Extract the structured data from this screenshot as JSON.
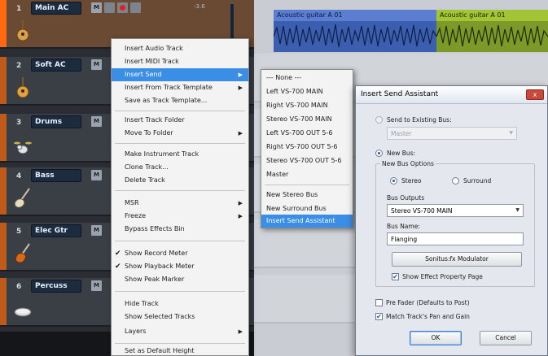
{
  "tracks": [
    {
      "num": "1",
      "name": "Main AC",
      "db": "-3.6",
      "selected": true
    },
    {
      "num": "2",
      "name": "Soft AC"
    },
    {
      "num": "3",
      "name": "Drums"
    },
    {
      "num": "4",
      "name": "Bass"
    },
    {
      "num": "5",
      "name": "Elec Gtr"
    },
    {
      "num": "6",
      "name": "Percuss"
    }
  ],
  "track_buttons": {
    "mute": "M"
  },
  "clips": {
    "clip_a_title": "Acoustic guitar A 01",
    "clip_b_title": "Acoustic guitar A 01",
    "clip_a_color": "#3b5fae",
    "clip_b_color": "#7c9a28"
  },
  "context_menu": {
    "items": [
      "Insert Audio Track",
      "Insert MIDI Track",
      "Insert Send",
      "Insert From Track Template",
      "Save as Track Template...",
      "Insert Track Folder",
      "Move To Folder",
      "Make Instrument Track",
      "Clone Track...",
      "Delete Track",
      "MSR",
      "Freeze",
      "Bypass Effects Bin",
      "Show Record Meter",
      "Show Playback Meter",
      "Show Peak Marker",
      "Hide Track",
      "Show Selected Tracks",
      "Layers",
      "Set as Default Height"
    ],
    "highlighted": "Insert Send",
    "highlight_color": "#3a8ee6"
  },
  "submenu": {
    "items": [
      "--- None ---",
      "Left VS-700 MAIN",
      "Right VS-700 MAIN",
      "Stereo VS-700 MAIN",
      "Left VS-700 OUT 5-6",
      "Right VS-700 OUT 5-6",
      "Stereo VS-700 OUT 5-6",
      "Master",
      "New Stereo Bus",
      "New Surround Bus",
      "Insert Send Assistant"
    ],
    "highlighted": "Insert Send Assistant"
  },
  "dialog": {
    "title": "Insert Send Assistant",
    "close_label": "x",
    "send_existing_label": "Send to Existing Bus:",
    "existing_bus_value": "Master",
    "new_bus_label": "New Bus:",
    "new_bus_options_label": "New Bus Options",
    "stereo_label": "Stereo",
    "surround_label": "Surround",
    "bus_outputs_label": "Bus Outputs",
    "bus_outputs_value": "Stereo VS-700 MAIN",
    "bus_name_label": "Bus Name:",
    "bus_name_value": "Flanging",
    "effect_button": "Sonitus:fx Modulator",
    "show_effect_label": "Show Effect Property Page",
    "pre_fader_label": "Pre Fader (Defaults to Post)",
    "match_label": "Match Track's Pan and Gain",
    "ok_label": "OK",
    "cancel_label": "Cancel",
    "show_effect_checked": true,
    "pre_fader_checked": false,
    "match_checked": true
  }
}
